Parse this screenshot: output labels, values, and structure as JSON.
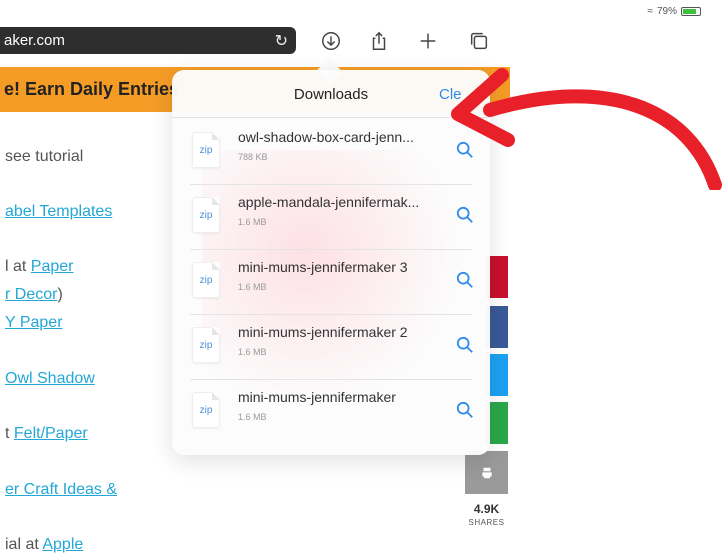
{
  "status": {
    "battery": "79%"
  },
  "toolbar": {
    "url": "aker.com",
    "icons": [
      "reload-icon",
      "download-icon",
      "share-icon",
      "plus-icon",
      "tabs-icon"
    ]
  },
  "page": {
    "banner": "e! Earn Daily Entries",
    "lines": [
      {
        "pre": "see tutorial",
        "link": "",
        "post": ""
      },
      {
        "pre": "",
        "link": "abel Templates",
        "post": ""
      },
      {
        "pre": "l at ",
        "link": "Paper",
        "post": ""
      },
      {
        "pre": "",
        "link": "r Decor",
        "post": ")"
      },
      {
        "pre": "",
        "link": "Y Paper",
        "post": ""
      },
      {
        "pre": "",
        "link": "Owl Shadow",
        "post": ""
      },
      {
        "pre": "t ",
        "link": "Felt/Paper",
        "post": ""
      },
      {
        "pre": "",
        "link": "er Craft Ideas &",
        "post": ""
      },
      {
        "pre": "ial at ",
        "link": "Apple",
        "post": ""
      }
    ]
  },
  "share": {
    "count": "4.9K",
    "label": "SHARES",
    "colors": [
      "#c8102e",
      "#3b5998",
      "#1da1f2",
      "#2aa84a"
    ]
  },
  "downloads": {
    "title": "Downloads",
    "clear_label": "Cle",
    "items": [
      {
        "name": "owl-shadow-box-card-jenn...",
        "size": "788 KB",
        "type": "zip"
      },
      {
        "name": "apple-mandala-jennifermak...",
        "size": "1.6 MB",
        "type": "zip"
      },
      {
        "name": "mini-mums-jennifermaker 3",
        "size": "1.6 MB",
        "type": "zip"
      },
      {
        "name": "mini-mums-jennifermaker 2",
        "size": "1.6 MB",
        "type": "zip"
      },
      {
        "name": "mini-mums-jennifermaker",
        "size": "1.6 MB",
        "type": "zip"
      }
    ]
  },
  "accent": "#2f8bea",
  "annotation_color": "#e8202a"
}
